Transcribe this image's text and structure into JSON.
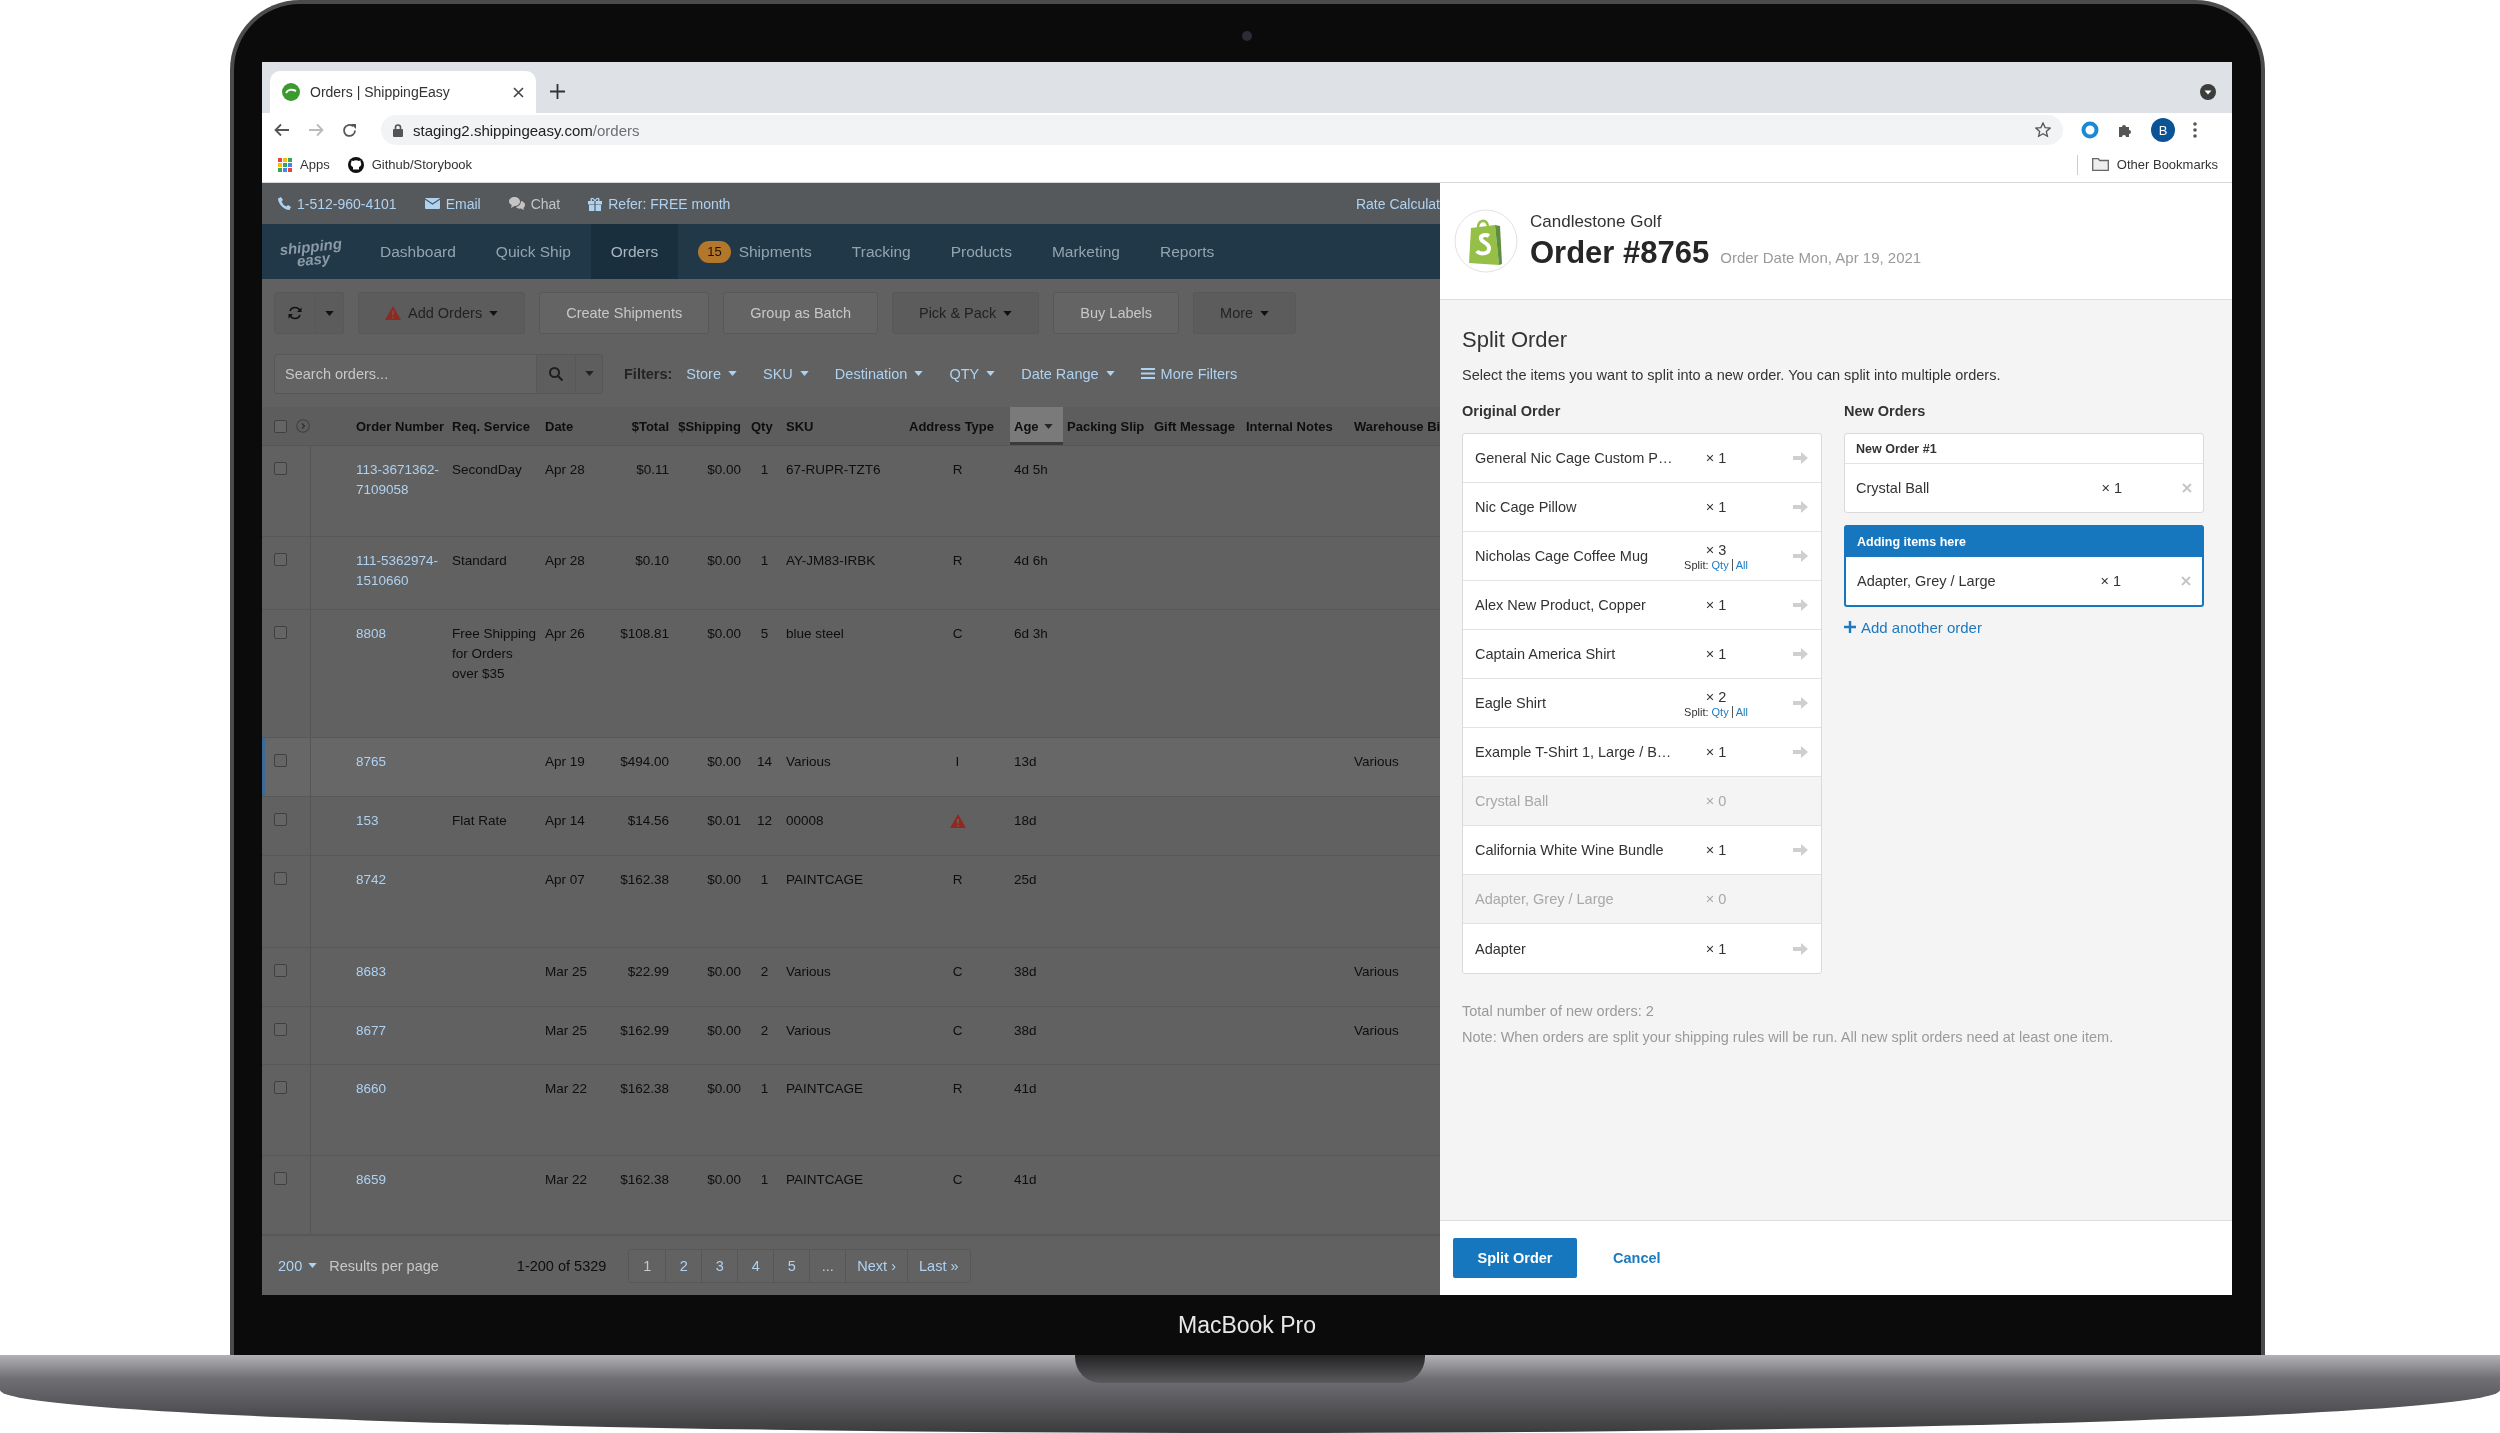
{
  "device": {
    "label": "MacBook Pro"
  },
  "browser": {
    "tab": {
      "title": "Orders | ShippingEasy"
    },
    "address": {
      "host": "staging2.shippingeasy.com",
      "path": "/orders"
    },
    "profile": {
      "initial": "B"
    },
    "bookmarks": [
      {
        "kind": "apps",
        "label": "Apps"
      },
      {
        "kind": "github",
        "label": "Github/Storybook"
      }
    ],
    "other_bookmarks": {
      "label": "Other Bookmarks"
    }
  },
  "app": {
    "contact_bar": {
      "items": [
        {
          "kind": "phone",
          "label": "1-512-960-4101",
          "disabled": false
        },
        {
          "kind": "email",
          "label": "Email",
          "disabled": false
        },
        {
          "kind": "chat",
          "label": "Chat",
          "disabled": true
        },
        {
          "kind": "gift",
          "label": "Refer: FREE month",
          "disabled": false
        }
      ],
      "link": "Rate Calculat"
    },
    "nav": {
      "logo": [
        "shipping",
        "easy"
      ],
      "items": [
        {
          "label": "Dashboard",
          "selected": false
        },
        {
          "label": "Quick Ship",
          "selected": false
        },
        {
          "label": "Orders",
          "selected": true
        },
        {
          "label": "Shipments",
          "badge": "15",
          "selected": false
        },
        {
          "label": "Tracking",
          "selected": false
        },
        {
          "label": "Products",
          "selected": false
        },
        {
          "label": "Marketing",
          "selected": false
        },
        {
          "label": "Reports",
          "selected": false
        }
      ]
    },
    "toolbar": [
      {
        "kind": "refresh",
        "dropdown": true,
        "disabled": false
      },
      {
        "kind": "button",
        "label": "Add Orders",
        "warning": true,
        "dropdown": true,
        "disabled": false
      },
      {
        "kind": "button",
        "label": "Create Shipments",
        "warning": false,
        "dropdown": false,
        "disabled": true
      },
      {
        "kind": "button",
        "label": "Group as Batch",
        "warning": false,
        "dropdown": false,
        "disabled": true
      },
      {
        "kind": "button",
        "label": "Pick & Pack",
        "warning": false,
        "dropdown": true,
        "disabled": false
      },
      {
        "kind": "button",
        "label": "Buy Labels",
        "warning": false,
        "dropdown": false,
        "disabled": true
      },
      {
        "kind": "button",
        "label": "More",
        "warning": false,
        "dropdown": true,
        "disabled": false
      }
    ],
    "search": {
      "placeholder": "Search orders..."
    },
    "filters": {
      "label": "Filters:",
      "items": [
        "Store",
        "SKU",
        "Destination",
        "QTY",
        "Date Range"
      ],
      "more": "More Filters"
    },
    "table": {
      "select_all": {
        "checked": false
      },
      "columns": [
        {
          "label": "Order Number",
          "sorted": false
        },
        {
          "label": "Req. Service",
          "sorted": false
        },
        {
          "label": "Date",
          "sorted": false
        },
        {
          "label": "$Total",
          "sorted": false
        },
        {
          "label": "$Shipping",
          "sorted": false
        },
        {
          "label": "Qty",
          "sorted": false
        },
        {
          "label": "SKU",
          "sorted": false
        },
        {
          "label": "Address Type",
          "sorted": false
        },
        {
          "label": "Age",
          "sorted": true
        },
        {
          "label": "Packing Slip",
          "sorted": false
        },
        {
          "label": "Gift Message",
          "sorted": false
        },
        {
          "label": "Internal Notes",
          "sorted": false
        },
        {
          "label": "Warehouse Bi",
          "sorted": false
        }
      ],
      "rows": [
        {
          "order": "113-3671362-7109058",
          "service": "SecondDay",
          "date": "Apr 28",
          "total": "$0.11",
          "shipping": "$0.00",
          "qty": "1",
          "sku": "67-RUPR-TZT6",
          "address_type": "R",
          "address_warning": false,
          "age": "4d 5h",
          "checked": false,
          "selected": false
        },
        {
          "order": "111-5362974-1510660",
          "service": "Standard",
          "date": "Apr 28",
          "total": "$0.10",
          "shipping": "$0.00",
          "qty": "1",
          "sku": "AY-JM83-IRBK",
          "address_type": "R",
          "address_warning": false,
          "age": "4d 6h",
          "checked": false,
          "selected": false
        },
        {
          "order": "8808",
          "service": "Free Shipping for Orders over $35",
          "date": "Apr 26",
          "total": "$108.81",
          "shipping": "$0.00",
          "qty": "5",
          "sku": "blue steel",
          "address_type": "C",
          "address_warning": false,
          "age": "6d 3h",
          "checked": false,
          "selected": false
        },
        {
          "order": "8765",
          "date": "Apr 19",
          "total": "$494.00",
          "shipping": "$0.00",
          "qty": "14",
          "sku": "Various",
          "address_type": "I",
          "address_warning": false,
          "age": "13d",
          "warehouse": "Various",
          "checked": false,
          "selected": true
        },
        {
          "order": "153",
          "service": "Flat Rate",
          "date": "Apr 14",
          "total": "$14.56",
          "shipping": "$0.01",
          "qty": "12",
          "sku": "00008",
          "address_warning": true,
          "age": "18d",
          "checked": false,
          "selected": false
        },
        {
          "order": "8742",
          "date": "Apr 07",
          "total": "$162.38",
          "shipping": "$0.00",
          "qty": "1",
          "sku": "PAINTCAGE",
          "address_type": "R",
          "address_warning": false,
          "age": "25d",
          "checked": false,
          "selected": false
        },
        {
          "order": "8683",
          "date": "Mar 25",
          "total": "$22.99",
          "shipping": "$0.00",
          "qty": "2",
          "sku": "Various",
          "address_type": "C",
          "address_warning": false,
          "age": "38d",
          "warehouse": "Various",
          "checked": false,
          "selected": false
        },
        {
          "order": "8677",
          "date": "Mar 25",
          "total": "$162.99",
          "shipping": "$0.00",
          "qty": "2",
          "sku": "Various",
          "address_type": "C",
          "address_warning": false,
          "age": "38d",
          "warehouse": "Various",
          "checked": false,
          "selected": false
        },
        {
          "order": "8660",
          "date": "Mar 22",
          "total": "$162.38",
          "shipping": "$0.00",
          "qty": "1",
          "sku": "PAINTCAGE",
          "address_type": "R",
          "address_warning": false,
          "age": "41d",
          "checked": false,
          "selected": false
        },
        {
          "order": "8659",
          "date": "Mar 22",
          "total": "$162.38",
          "shipping": "$0.00",
          "qty": "1",
          "sku": "PAINTCAGE",
          "address_type": "C",
          "address_warning": false,
          "age": "41d",
          "checked": false,
          "selected": false
        }
      ]
    },
    "pagination": {
      "per_page": "200",
      "per_page_label": "Results per page",
      "summary": "1-200 of 5329",
      "pages": [
        {
          "label": "1",
          "selected": true
        },
        {
          "label": "2",
          "selected": false
        },
        {
          "label": "3",
          "selected": false
        },
        {
          "label": "4",
          "selected": false
        },
        {
          "label": "5",
          "selected": false
        },
        {
          "label": "...",
          "selected": false
        },
        {
          "label": "Next ›",
          "selected": false
        },
        {
          "label": "Last »",
          "selected": false
        }
      ]
    }
  },
  "split_panel": {
    "store": "Candlestone Golf",
    "order_title": "Order #8765",
    "order_date": "Order Date Mon, Apr 19, 2021",
    "heading": "Split Order",
    "instructions": "Select the items you want to split into a new order. You can split into multiple orders.",
    "original_order": {
      "title": "Original Order",
      "items": [
        {
          "name": "General Nic Cage Custom P…",
          "qty": "× 1",
          "disabled": false
        },
        {
          "name": "Nic Cage Pillow",
          "qty": "× 1",
          "disabled": false
        },
        {
          "name": "Nicholas Cage Coffee Mug",
          "qty": "× 3",
          "split": {
            "label": "Split:",
            "links": [
              "Qty",
              "All"
            ]
          },
          "disabled": false
        },
        {
          "name": "Alex New Product, Copper",
          "qty": "× 1",
          "disabled": false
        },
        {
          "name": "Captain America Shirt",
          "qty": "× 1",
          "disabled": false
        },
        {
          "name": "Eagle Shirt",
          "qty": "× 2",
          "split": {
            "label": "Split:",
            "links": [
              "Qty",
              "All"
            ]
          },
          "disabled": false
        },
        {
          "name": "Example T-Shirt 1, Large / B…",
          "qty": "× 1",
          "disabled": false
        },
        {
          "name": "Crystal Ball",
          "qty": "× 0",
          "disabled": true
        },
        {
          "name": "California White Wine Bundle",
          "qty": "× 1",
          "disabled": false
        },
        {
          "name": "Adapter, Grey / Large",
          "qty": "× 0",
          "disabled": true
        },
        {
          "name": "Adapter",
          "qty": "× 1",
          "disabled": false
        }
      ]
    },
    "new_orders": {
      "title": "New Orders",
      "orders": [
        {
          "title": "New Order #1",
          "active": false,
          "items": [
            {
              "name": "Crystal Ball",
              "qty": "× 1"
            }
          ]
        },
        {
          "title": "Adding items here",
          "active": true,
          "items": [
            {
              "name": "Adapter, Grey / Large",
              "qty": "× 1"
            }
          ]
        }
      ],
      "add_link": "Add another order"
    },
    "total": "Total number of new orders: 2",
    "note": "Note: When orders are split your shipping rules will be run. All new split orders need at least one item.",
    "buttons": [
      {
        "kind": "primary",
        "label": "Split Order"
      },
      {
        "kind": "link",
        "label": "Cancel"
      }
    ]
  }
}
